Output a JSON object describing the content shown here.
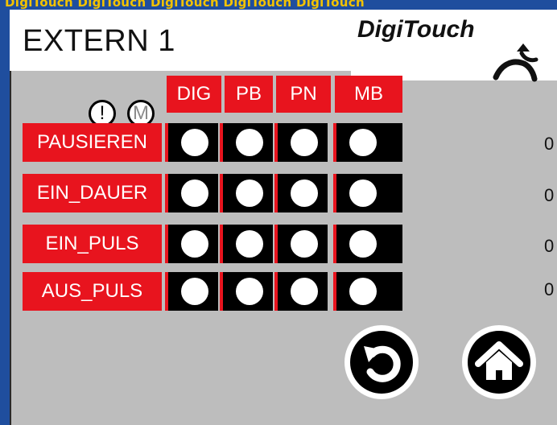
{
  "header": {
    "title": "EXTERN 1",
    "logo_text": "DigiTouch",
    "top_strip_text": "DigiTouch DigiTouch DigiTouch DigiTouch DigiTouch"
  },
  "columns": [
    "DIG",
    "PB",
    "PN",
    "MB"
  ],
  "indicators": {
    "alert": "!",
    "mode": "M"
  },
  "rows": [
    {
      "label": "PAUSIEREN",
      "value": "0"
    },
    {
      "label": "EIN_DAUER",
      "value": "0"
    },
    {
      "label": "EIN_PULS",
      "value": "0"
    },
    {
      "label": "AUS_PULS",
      "value": "0"
    }
  ],
  "buttons": {
    "back": "back-icon",
    "home": "home-icon"
  },
  "colors": {
    "accent_red": "#E8141E",
    "panel_gray": "#BDBDBD",
    "frame_blue": "#1F4E9E"
  }
}
